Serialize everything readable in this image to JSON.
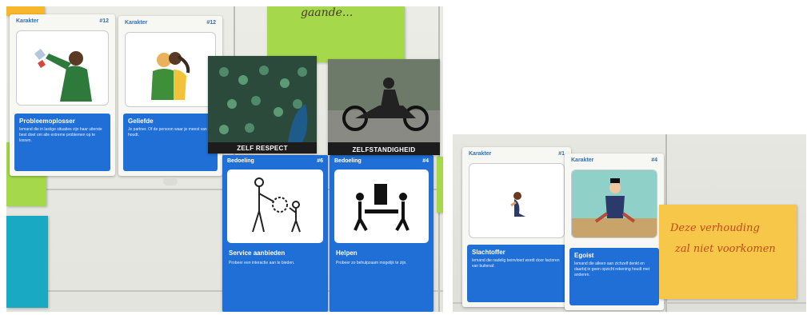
{
  "left_photo": {
    "handwriting": "gaande...",
    "cards": [
      {
        "category": "Karakter",
        "number": "#12",
        "title": "Probleemoplosser",
        "text": "Iemand die in lastige situaties zijn haar uiterste best doet om alle extreme problemen op te lossen."
      },
      {
        "category": "Karakter",
        "number": "#12",
        "title": "Geliefde",
        "text": "Je partner. Of de persoon waar je meest van houdt."
      }
    ],
    "photo_cards": [
      {
        "label": "ZELF RESPECT"
      },
      {
        "label": "ZELFSTANDIGHEID"
      }
    ],
    "blue_cards": [
      {
        "category": "Bedoeling",
        "number": "#6",
        "title": "Service aanbieden",
        "text": "Probeer een interactie aan te bieden."
      },
      {
        "category": "Bedoeling",
        "number": "#4",
        "title": "Helpen",
        "text": "Probeer zo behulpzaam mogelijk te zijn."
      }
    ]
  },
  "right_photo": {
    "cards": [
      {
        "category": "Karakter",
        "number": "#1",
        "title": "Slachtoffer",
        "text": "Iemand die nadelig beinvloed wordt door factoren van buitenaf."
      },
      {
        "category": "Karakter",
        "number": "#4",
        "title": "Egoist",
        "text": "Iemand die alleen aan zichzelf denkt en daarbij in geen opzicht rekening houdt met anderen."
      }
    ],
    "note": {
      "line1": "Deze verhouding",
      "line2": "zal niet voorkomen"
    }
  },
  "colors": {
    "card_blue": "#1f6fd6",
    "sticky_green": "#a5d84a",
    "sticky_teal": "#1aa9c2",
    "sticky_orange": "#f8b62d",
    "sticky_yellow": "#f7c74a"
  }
}
